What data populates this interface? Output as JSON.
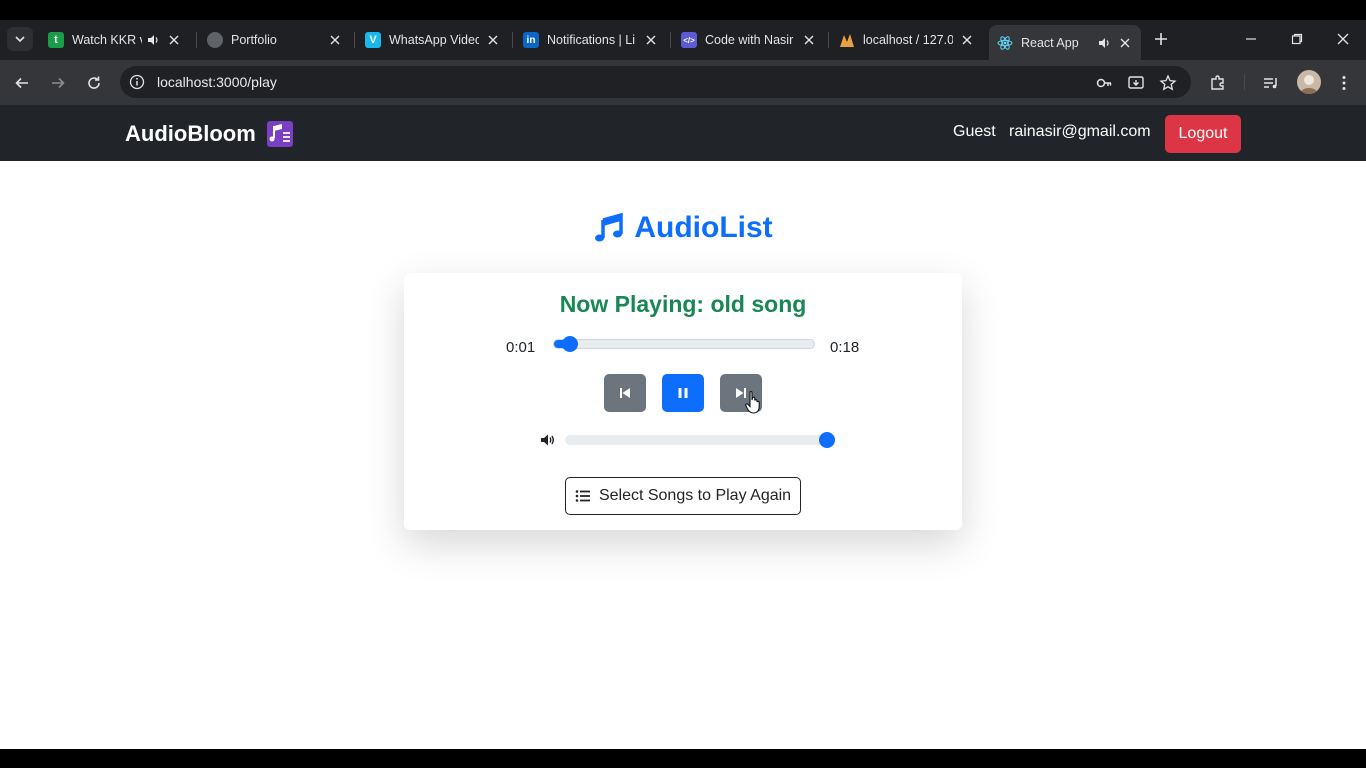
{
  "browser": {
    "tabs": [
      {
        "title": "Watch KKR v",
        "favicon": "t",
        "favicon_color": "#1a9c4a",
        "audio": true
      },
      {
        "title": "Portfolio",
        "favicon": "globe",
        "favicon_color": "#5f6368",
        "audio": false
      },
      {
        "title": "WhatsApp Videc",
        "favicon": "V",
        "favicon_color": "#1ab7ea",
        "audio": false
      },
      {
        "title": "Notifications | Li",
        "favicon": "in",
        "favicon_color": "#0a66c2",
        "audio": false
      },
      {
        "title": "Code with Nasir",
        "favicon": "</>",
        "favicon_color": "#5b5bd6",
        "audio": false
      },
      {
        "title": "localhost / 127.0",
        "favicon": "pma",
        "favicon_color": "#e8a33d",
        "audio": false
      },
      {
        "title": "React App",
        "favicon": "react",
        "favicon_color": "#61dafb",
        "audio": true
      }
    ],
    "url": "localhost:3000/play"
  },
  "app": {
    "brand": "AudioBloom",
    "user": "Guest",
    "email": "rainasir@gmail.com",
    "logout_label": "Logout",
    "heading": "AudioList",
    "now_playing": "Now Playing: old song",
    "current_time": "0:01",
    "total_time": "0:18",
    "progress_fraction": 0.06,
    "volume_fraction": 1.0,
    "again_label": "Select Songs to Play Again"
  },
  "colors": {
    "primary": "#0d6efd",
    "success": "#198754",
    "danger": "#dc3545",
    "secondary": "#6c757d",
    "navbar": "#212529"
  }
}
